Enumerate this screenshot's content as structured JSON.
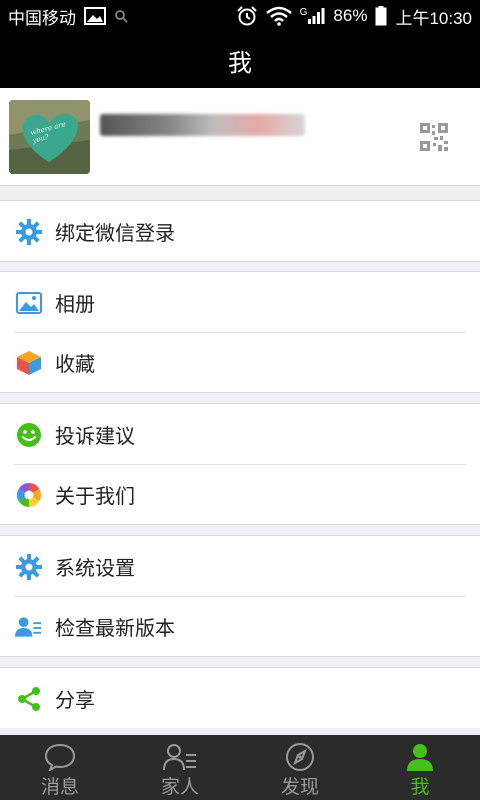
{
  "status_bar": {
    "carrier": "中国移动",
    "battery": "86%",
    "network": "G",
    "time": "上午10:30"
  },
  "header": {
    "title": "我"
  },
  "profile": {
    "avatar_text": "where are you?",
    "qr_icon": "qr-code-icon"
  },
  "menu": {
    "bind_wechat": {
      "label": "绑定微信登录",
      "icon": "gear-icon",
      "color": "#3a9be0"
    },
    "album": {
      "label": "相册",
      "icon": "image-icon",
      "color": "#3a9be0"
    },
    "favorites": {
      "label": "收藏",
      "icon": "cube-icon"
    },
    "feedback": {
      "label": "投诉建议",
      "icon": "smiley-icon",
      "color": "#45c01a"
    },
    "about": {
      "label": "关于我们",
      "icon": "aperture-icon"
    },
    "settings": {
      "label": "系统设置",
      "icon": "gear-icon",
      "color": "#3a9be0"
    },
    "check_update": {
      "label": "检查最新版本",
      "icon": "user-list-icon",
      "color": "#3a9be0"
    },
    "share": {
      "label": "分享",
      "icon": "share-icon",
      "color": "#45c01a"
    }
  },
  "tabs": [
    {
      "label": "消息",
      "icon": "chat-bubble-icon",
      "active": false
    },
    {
      "label": "家人",
      "icon": "contacts-icon",
      "active": false
    },
    {
      "label": "发现",
      "icon": "compass-icon",
      "active": false
    },
    {
      "label": "我",
      "icon": "person-icon",
      "active": true
    }
  ],
  "colors": {
    "status_bg": "#000000",
    "tab_bar_bg": "#2b2b2b",
    "accent_green": "#45c01a",
    "accent_blue": "#3a9be0",
    "page_bg": "#efeff4"
  }
}
